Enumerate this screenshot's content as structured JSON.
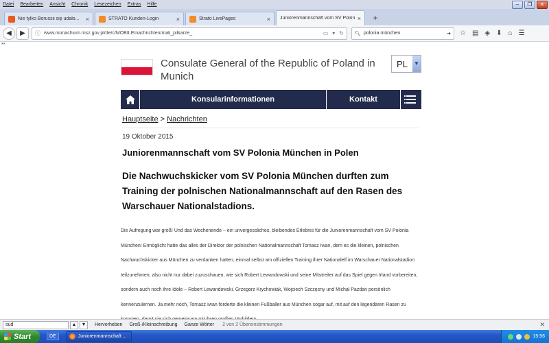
{
  "browser": {
    "menu": [
      "Datei",
      "Bearbeiten",
      "Ansicht",
      "Chronik",
      "Lesezeichen",
      "Extras",
      "Hilfe"
    ],
    "tabs": [
      {
        "title": "Nie tylko Borussii się udało...",
        "active": false,
        "favicon_color": "#e85a1e"
      },
      {
        "title": "STRATO Kunden-Login",
        "active": false,
        "favicon_color": "#f28c28"
      },
      {
        "title": "Strato LivePages",
        "active": false,
        "favicon_color": "#f28c28"
      },
      {
        "title": "Juniorenmannschaft vom SV Polon...",
        "active": true,
        "favicon_color": ""
      }
    ],
    "url": "www.monachium.msz.gov.pl/de/c/MOBILE/nachrichten/mali_pilkarze_",
    "search_query": "polonia münchen"
  },
  "page": {
    "site_title": "Consulate General of the Republic of Poland in Munich",
    "language": "PL",
    "nav": {
      "konsular": "Konsularinformationen",
      "kontakt": "Kontakt"
    },
    "breadcrumb": {
      "home": "Hauptseite",
      "sep": " > ",
      "current": "Nachrichten"
    },
    "date": "19 Oktober 2015",
    "headline": "Juniorenmannschaft vom SV Polonia München in Polen",
    "lead": "Die Nachwuchskicker vom SV Polonia München durften zum Training der polnischen Nationalmannschaft auf den Rasen des Warschauer Nationalstadions.",
    "body": "Die Aufregung war groß! Und das Wochenende – ein unvergessliches, bleibendes Erlebnis für die Juniorenmannschaft vom SV Polonia München! Ermöglicht hatte das alles der Direktor der polnischen Nationalmannschaft Tomasz Iwan, dem es die kleinen, polnischen Nachwuchskicker aus München zu verdanken hatten, einmal selbst am offiziellen Training ihrer Nationalelf im Warschauer Nationalstadion teilzunehmen, also nicht nur dabei zuzuschauen, wie sich Robert Lewandowski und seine Mitstreiter auf das Spiel gegen Irland vorbereiten, sondern auch noch ihre Idole – Robert Lewandowski, Grzegorz Krychowiak, Wojciech Szczęsny und Michał Pazdan persönlich kennenzulernen. Ja mehr noch, Tomasz Iwan forderte die kleinen Fußballer aus München sogar auf, mit auf den legendären Rasen zu kommen, damit sie sich gemeinsam mit ihren großen Vorbildern"
  },
  "findbar": {
    "value": "sud",
    "highlight": "Hervorheben",
    "case": "Groß-/Kleinschreibung",
    "whole": "Ganze Wörter",
    "status": "2 von 2 Übereinstimmungen"
  },
  "taskbar": {
    "start": "Start",
    "lang": "DE",
    "task": "Juniorenmannschaft ...",
    "clock": "15:56"
  },
  "colors": {
    "nav_bg": "#232b4d",
    "flag_red": "#dc143c"
  }
}
